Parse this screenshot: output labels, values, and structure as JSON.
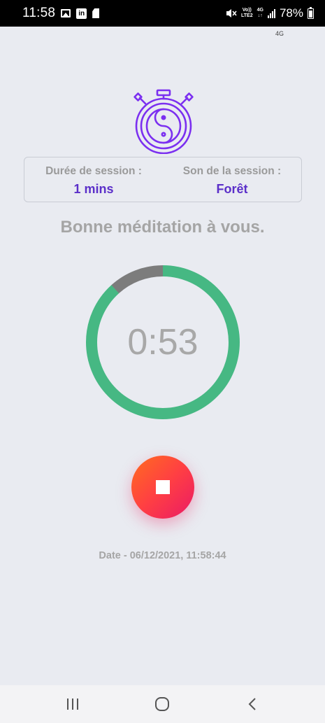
{
  "status_bar": {
    "time": "11:58",
    "battery": "78%",
    "volte_top": "Vo))",
    "volte_bottom": "LTE2",
    "net_top": "4G",
    "net_bottom": "↓↑",
    "icons": [
      "image-icon",
      "linkedin-icon",
      "sim-icon",
      "mute-icon",
      "signal-icon",
      "battery-icon"
    ]
  },
  "network_small": "4G",
  "logo": {
    "icon": "stopwatch-yin-yang-icon",
    "color": "#7b2ff0"
  },
  "session": {
    "duration_label": "Durée de session :",
    "duration_value": "1 mins",
    "sound_label": "Son de la session :",
    "sound_value": "Forêt"
  },
  "greeting": "Bonne méditation à vous.",
  "progress": {
    "remaining_text": "0:53",
    "fraction_remaining": 0.883,
    "remaining_color": "#46b883",
    "elapsed_color": "#7c7c7c"
  },
  "stop_button": {
    "icon": "stop-icon"
  },
  "date_line": "Date - 06/12/2021, 11:58:44",
  "nav": {
    "icons": [
      "recents-icon",
      "home-icon",
      "back-icon"
    ]
  }
}
